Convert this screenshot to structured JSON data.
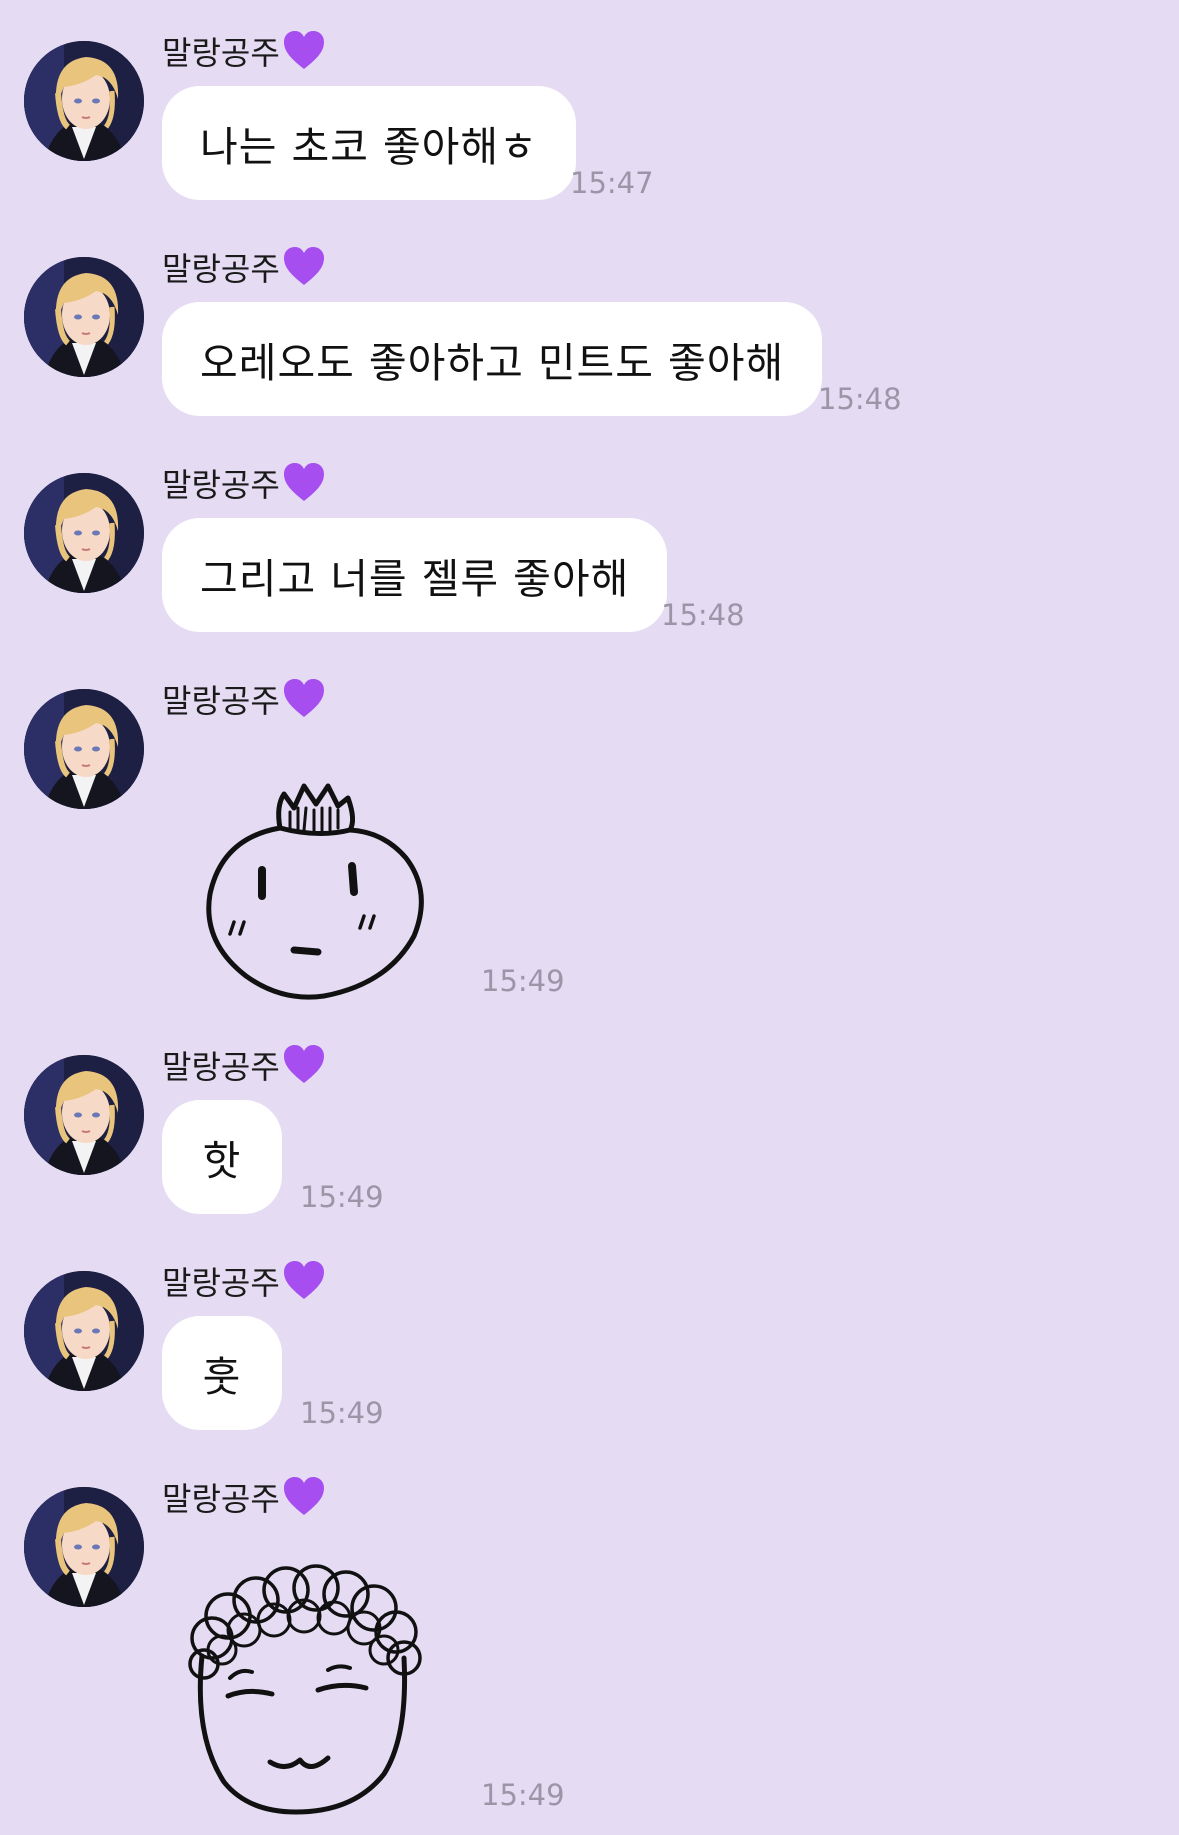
{
  "chat": {
    "messages": [
      {
        "sender": "말랑공주",
        "type": "text",
        "text": "나는 초코 좋아해ㅎ",
        "time": "15:47"
      },
      {
        "sender": "말랑공주",
        "type": "text",
        "text": "오레오도 좋아하고 민트도 좋아해",
        "time": "15:48"
      },
      {
        "sender": "말랑공주",
        "type": "text",
        "text": "그리고 너를 젤루 좋아해",
        "time": "15:48"
      },
      {
        "sender": "말랑공주",
        "type": "sticker",
        "sticker": "crowned-face-sticker",
        "time": "15:49"
      },
      {
        "sender": "말랑공주",
        "type": "text",
        "text": "핫",
        "time": "15:49"
      },
      {
        "sender": "말랑공주",
        "type": "text",
        "text": "훗",
        "time": "15:49"
      },
      {
        "sender": "말랑공주",
        "type": "sticker",
        "sticker": "curly-hair-face-sticker",
        "time": "15:49"
      }
    ]
  },
  "colors": {
    "background": "#e5dcf4",
    "bubble": "#ffffff",
    "timestamp": "#9c95a6",
    "heart": "#a64ef0"
  }
}
